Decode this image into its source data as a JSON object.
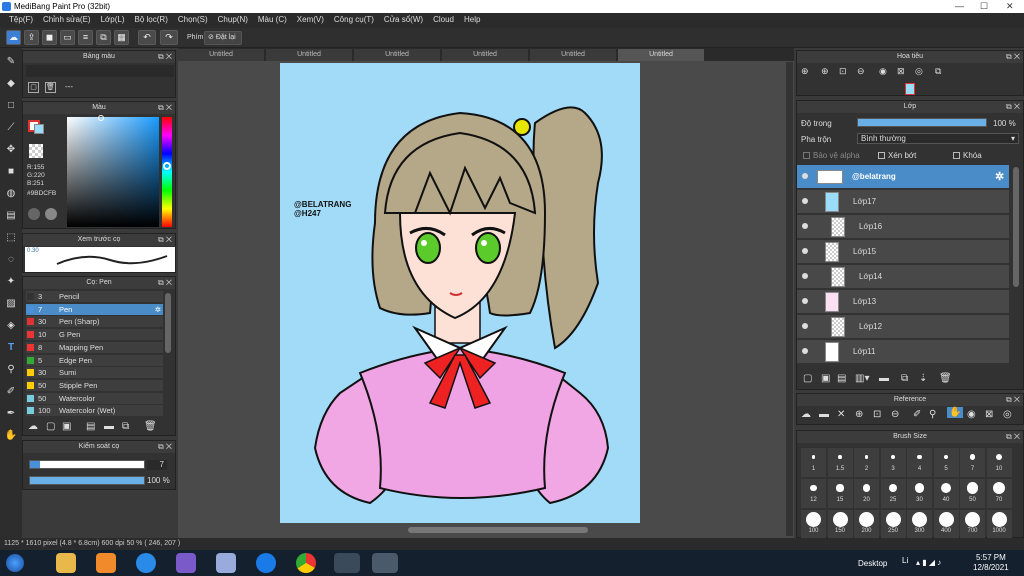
{
  "window": {
    "title": "MediBang Paint Pro (32bit)"
  },
  "menu": [
    "Tệp(F)",
    "Chỉnh sửa(E)",
    "Lớp(L)",
    "Bộ lọc(R)",
    "Chọn(S)",
    "Chụp(N)",
    "Màu (C)",
    "Xem(V)",
    "Công cụ(T)",
    "Cửa sổ(W)",
    "Cloud",
    "Help"
  ],
  "toolbar": {
    "shortcut_label": "Phím",
    "reset_label": "Đặt lại"
  },
  "panels": {
    "palette": {
      "title": "Bảng màu",
      "dash": "---"
    },
    "color": {
      "title": "Màu",
      "r": "R:155",
      "g": "G:220",
      "b": "B:251",
      "hex": "#9BDCFB",
      "current": "#9bdcfb"
    },
    "preview": {
      "title": "Xem trước cọ",
      "size": "0.30"
    },
    "brush": {
      "title": "Cọ: Pen",
      "items": [
        {
          "size": "3",
          "name": "Pencil",
          "color": "#333"
        },
        {
          "size": "7",
          "name": "Pen",
          "color": "#4a90d9"
        },
        {
          "size": "30",
          "name": "Pen (Sharp)",
          "color": "#d33"
        },
        {
          "size": "10",
          "name": "G Pen",
          "color": "#e33"
        },
        {
          "size": "8",
          "name": "Mapping Pen",
          "color": "#e33"
        },
        {
          "size": "5",
          "name": "Edge Pen",
          "color": "#3a3"
        },
        {
          "size": "30",
          "name": "Sumi",
          "color": "#fc0"
        },
        {
          "size": "50",
          "name": "Stipple Pen",
          "color": "#fc0"
        },
        {
          "size": "50",
          "name": "Watercolor",
          "color": "#7cd"
        },
        {
          "size": "100",
          "name": "Watercolor (Wet)",
          "color": "#7cd"
        }
      ]
    },
    "control": {
      "title": "Kiểm soát cọ",
      "size": "7",
      "opacity": "100 %",
      "opacity_fraction": 1.0
    }
  },
  "tabs": [
    "Untitled",
    "Untitled",
    "Untitled",
    "Untitled",
    "Untitled",
    "Untitled"
  ],
  "canvas": {
    "watermark1": "@BELATRANG",
    "watermark2": "@H247"
  },
  "navigator": {
    "title": "Hoa tiêu"
  },
  "layers": {
    "title": "Lớp",
    "opacity_label": "Độ trong",
    "opacity_value": "100 %",
    "opacity_fraction": 1.0,
    "blend_label": "Pha trộn",
    "blend_value": "Bình thường",
    "protect_alpha": "Bảo vệ alpha",
    "clip": "Xén bớt",
    "lock": "Khóa",
    "list": [
      "@belatrang",
      "Lớp17",
      "Lớp16",
      "Lớp15",
      "Lớp14",
      "Lớp13",
      "Lớp12",
      "Lớp11"
    ]
  },
  "reference": {
    "title": "Reference"
  },
  "brushsize": {
    "title": "Brush Size",
    "sizes": [
      "1",
      "1.5",
      "2",
      "3",
      "4",
      "5",
      "7",
      "10",
      "12",
      "15",
      "20",
      "25",
      "30",
      "40",
      "50",
      "70",
      "100",
      "150",
      "200",
      "250",
      "300",
      "400",
      "700",
      "1000"
    ]
  },
  "status": {
    "text": "1125 * 1610 pixel  (4.8 * 6.8cm)  600 dpi  50 %  ( 246, 207 )"
  },
  "taskbar": {
    "desktop": "Desktop",
    "lang": "Li",
    "time": "5:57 PM",
    "date": "12/8/2021"
  }
}
